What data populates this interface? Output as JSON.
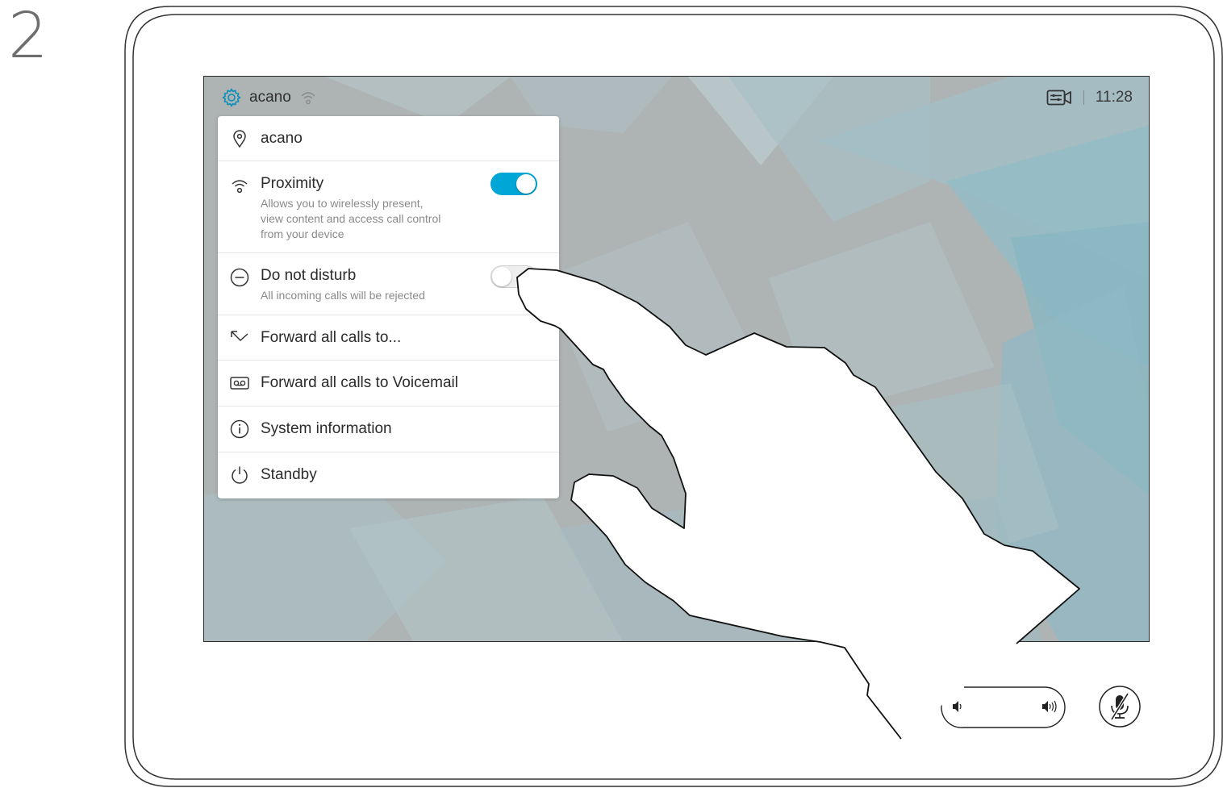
{
  "step_number": "2",
  "statusbar": {
    "settings_icon": "gear-icon",
    "device_name": "acano",
    "proximity_icon": "proximity-icon",
    "camera_icon": "selfview-camera-icon",
    "time": "11:28"
  },
  "menu": {
    "items": [
      {
        "icon": "location-pin-icon",
        "title": "acano"
      },
      {
        "icon": "proximity-icon",
        "title": "Proximity",
        "description": [
          "Allows you to wirelessly present,",
          "view content and access call control",
          "from your device"
        ],
        "toggle": true
      },
      {
        "icon": "minus-circle-icon",
        "title": "Do not disturb",
        "description": [
          "All incoming calls will be rejected"
        ],
        "toggle": false
      },
      {
        "icon": "forward-arrow-icon",
        "title": "Forward all calls to..."
      },
      {
        "icon": "voicemail-icon",
        "title": "Forward all calls to Voicemail"
      },
      {
        "icon": "info-icon",
        "title": "System information"
      },
      {
        "icon": "power-icon",
        "title": "Standby"
      }
    ]
  },
  "controls": {
    "volume_down_icon": "speaker-low-icon",
    "volume_up_icon": "speaker-high-icon",
    "mute_icon": "microphone-muted-icon"
  },
  "colors": {
    "accent": "#00a6d6",
    "screen_background": "#aeb3b4"
  }
}
